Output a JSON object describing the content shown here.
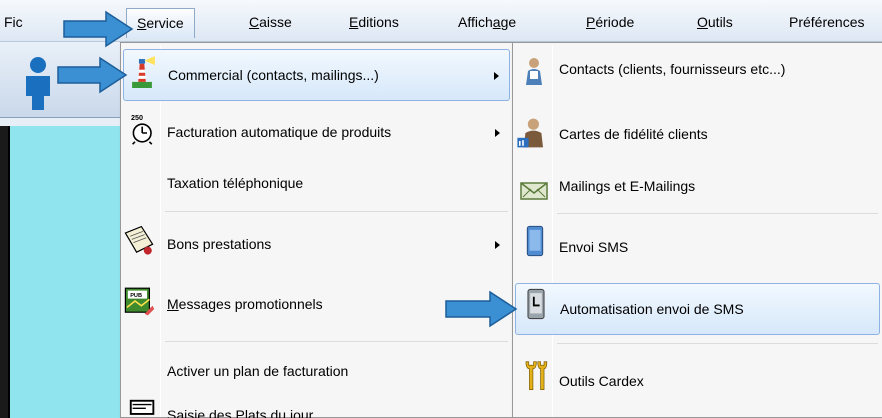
{
  "menubar": {
    "items": [
      {
        "label": "Fic"
      },
      {
        "u": "S",
        "rest": "ervice"
      },
      {
        "u": "C",
        "rest": "aisse"
      },
      {
        "u": "E",
        "rest": "ditions"
      },
      {
        "pre": "Affich",
        "u": "a",
        "rest": "ge"
      },
      {
        "u": "P",
        "rest": "ériode"
      },
      {
        "u": "O",
        "rest": "utils"
      },
      {
        "label": "Préférences"
      }
    ]
  },
  "service_menu": {
    "items": [
      {
        "label": "Commercial (contacts, mailings...)",
        "icon": "lighthouse-icon",
        "submenu": true
      },
      {
        "label": "Facturation automatique de produits",
        "icon": "clock-price-icon",
        "submenu": true
      },
      {
        "label": "Taxation téléphonique",
        "icon": "",
        "submenu": false
      },
      {
        "label": "Bons prestations",
        "icon": "voucher-icon",
        "submenu": true
      },
      {
        "u": "M",
        "rest": "essages promotionnels",
        "icon": "promo-message-icon",
        "submenu": false
      },
      {
        "label": "Activer un plan de facturation",
        "icon": "",
        "submenu": false
      },
      {
        "label": "Saisie des Plats du jour",
        "icon": "plate-icon",
        "submenu": false
      }
    ]
  },
  "commercial_submenu": {
    "items": [
      {
        "label": "Contacts (clients, fournisseurs etc...)",
        "icon": "contacts-icon"
      },
      {
        "label": "Cartes de fidélité clients",
        "icon": "loyalty-card-icon"
      },
      {
        "label": "Mailings et E-Mailings",
        "icon": "mailing-icon"
      },
      {
        "label": "Envoi SMS",
        "icon": "phone-icon"
      },
      {
        "label": "Automatisation envoi de SMS",
        "icon": "phone-clock-icon"
      },
      {
        "label": "Outils Cardex",
        "icon": "tools-icon"
      }
    ]
  },
  "colors": {
    "highlight": "#d6e8fa",
    "pointer_arrow": "#3b8fd3",
    "app_background": "#8fe4ee"
  }
}
